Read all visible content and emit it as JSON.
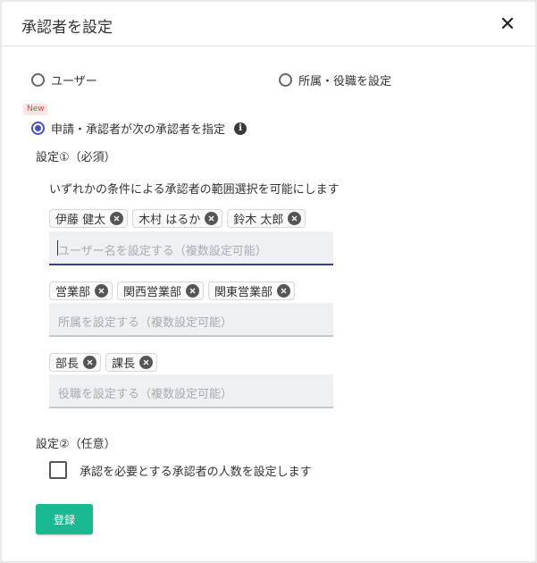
{
  "dialog": {
    "title": "承認者を設定",
    "close_icon": "close-icon"
  },
  "options": [
    {
      "label": "ユーザー",
      "selected": false
    },
    {
      "label": "所属・役職を設定",
      "selected": false
    },
    {
      "label": "申請・承認者が次の承認者を指定",
      "selected": true,
      "badge": "New",
      "info_icon": "info-icon"
    }
  ],
  "setting1": {
    "label": "設定①（必須）",
    "description": "いずれかの条件による承認者の範囲選択を可能にします",
    "users": {
      "chips": [
        "伊藤 健太",
        "木村 はるか",
        "鈴木 太郎"
      ],
      "placeholder": "ユーザー名を設定する（複数設定可能）"
    },
    "departments": {
      "chips": [
        "営業部",
        "関西営業部",
        "関東営業部"
      ],
      "placeholder": "所属を設定する（複数設定可能）"
    },
    "positions": {
      "chips": [
        "部長",
        "課長"
      ],
      "placeholder": "役職を設定する（複数設定可能）"
    }
  },
  "setting2": {
    "label": "設定②（任意）",
    "checkbox_label": "承認を必要とする承認者の人数を設定します",
    "checked": false
  },
  "submit_label": "登録",
  "colors": {
    "accent": "#4b4fc4",
    "submit": "#19b991",
    "badge_text": "#e0463f",
    "badge_bg": "#fde5e5"
  }
}
